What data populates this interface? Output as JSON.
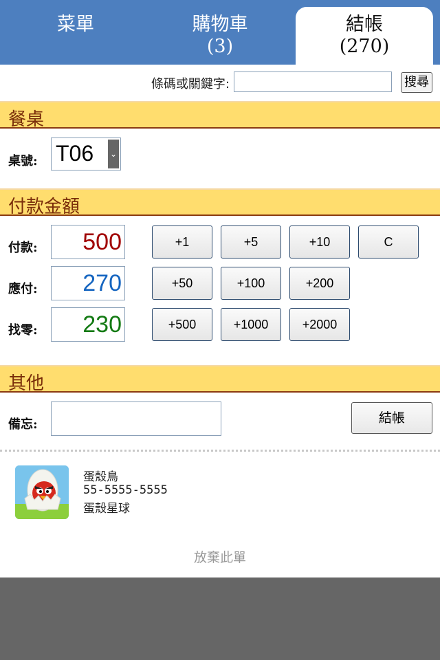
{
  "tabs": [
    {
      "label": "菜單",
      "sub": ""
    },
    {
      "label": "購物車",
      "sub": "(3)"
    },
    {
      "label": "結帳",
      "sub": "(270)"
    }
  ],
  "search": {
    "label": "條碼或關鍵字:",
    "placeholder": "",
    "button": "搜尋"
  },
  "sections": {
    "table": "餐桌",
    "payment": "付款金額",
    "other": "其他"
  },
  "table": {
    "label": "桌號:",
    "value": "T06"
  },
  "payment": {
    "paid_label": "付款:",
    "paid": "500",
    "paid_color": "#a00000",
    "due_label": "應付:",
    "due": "270",
    "due_color": "#1565c0",
    "change_label": "找零:",
    "change": "230",
    "change_color": "#137a13"
  },
  "quick_buttons": {
    "row1": [
      "+1",
      "+5",
      "+10",
      "C"
    ],
    "row2": [
      "+50",
      "+100",
      "+200"
    ],
    "row3": [
      "+500",
      "+1000",
      "+2000"
    ]
  },
  "memo": {
    "label": "備忘:",
    "value": ""
  },
  "checkout_button": "結帳",
  "customer": {
    "name": "蛋殼鳥",
    "phone": "55-5555-5555",
    "address": "蛋殼星球"
  },
  "cancel_link": "放棄此單",
  "colors": {
    "tabbar": "#4d7fbf",
    "section_bg": "#ffdd6e",
    "section_text": "#7a2e0a"
  }
}
